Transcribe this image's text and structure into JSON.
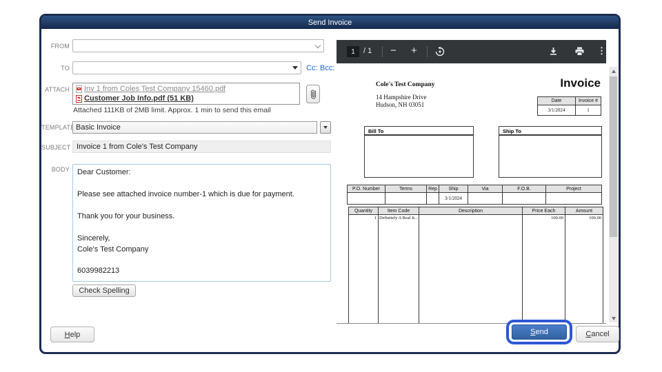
{
  "dialog": {
    "title": "Send Invoice"
  },
  "form": {
    "from_label": "FROM",
    "to_label": "TO",
    "cc_label": "Cc:",
    "bcc_label": "Bcc:",
    "attach_label": "ATTACH",
    "attachments": [
      {
        "name": "Inv 1 from Coles Test Company 15460.pdf"
      },
      {
        "name": "Customer Job Info.pdf (51 KB)"
      }
    ],
    "attach_note": "Attached 111KB of 2MB limit. Approx. 1 min to send this email",
    "template_label": "TEMPLATE",
    "template_value": "Basic Invoice",
    "subject_label": "SUBJECT",
    "subject_value": "Invoice 1 from Cole's Test Company",
    "body_label": "BODY",
    "body_value": "Dear Customer:\n\nPlease see attached invoice number-1 which is due for payment.\n\nThank you for your business.\n\nSincerely,\nCole's Test Company\n\n6039982213",
    "check_spelling_label": "Check Spelling"
  },
  "viewer": {
    "page_number": "1",
    "page_total": "/ 1"
  },
  "invoice": {
    "company": "Cole's Test Company",
    "address_line1": "14 Hampshire Drive",
    "address_line2": "Hudson, NH 03051",
    "title": "Invoice",
    "date_header": "Date",
    "invoice_no_header": "Invoice #",
    "date_value": "3/1/2024",
    "invoice_no_value": "1",
    "bill_to_label": "Bill To",
    "ship_to_label": "Ship To",
    "po_headers": [
      "P.O. Number",
      "Terms",
      "Rep",
      "Ship",
      "Via",
      "F.O.B.",
      "Project"
    ],
    "ship_date_value": "3/1/2024",
    "item_headers": [
      "Quantity",
      "Item Code",
      "Description",
      "Price Each",
      "Amount"
    ],
    "item_row": {
      "quantity": "1",
      "item_code": "Definitely A Real It...",
      "description": "",
      "price_each": "100.00",
      "amount": "100.00"
    }
  },
  "buttons": {
    "help_key": "H",
    "help_rest": "elp",
    "send_key": "S",
    "send_rest": "end",
    "cancel_key": "C",
    "cancel_rest": "ancel"
  },
  "colors": {
    "titlebar_navy": "#1d3a66",
    "frame_navy": "#1c2c50",
    "link_blue": "#1a66cc",
    "send_blue": "#3a6fc0",
    "highlight_ring_blue": "#2e57d4",
    "viewer_toolbar_gray": "#323639"
  }
}
